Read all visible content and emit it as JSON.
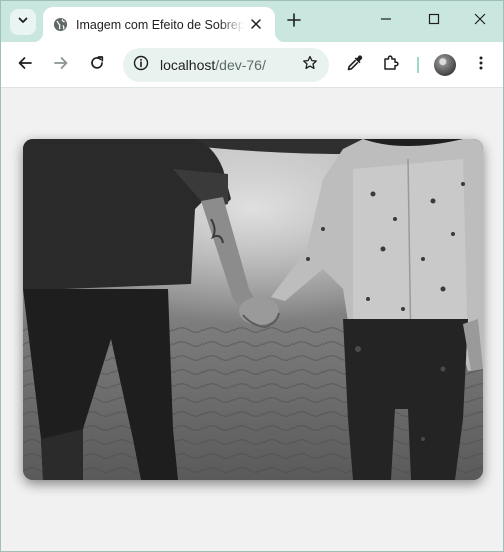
{
  "browser": {
    "tab": {
      "title": "Imagem com Efeito de Sobreposição",
      "favicon": "globe-icon"
    },
    "address_bar": {
      "host": "localhost",
      "path": "/dev-76/"
    },
    "icons": {
      "tab_search": "chevron-down-icon",
      "close_tab": "close-icon",
      "new_tab": "plus-icon",
      "minimize": "minimize-icon",
      "maximize": "maximize-icon",
      "close_window": "close-icon",
      "back": "arrow-left-icon",
      "forward": "arrow-right-icon",
      "reload": "reload-icon",
      "site_info": "info-icon",
      "bookmark": "star-icon",
      "eyedropper": "eyedropper-icon",
      "extensions": "puzzle-icon",
      "menu": "kebab-menu-icon"
    },
    "colors": {
      "frame": "#c9e6df",
      "omnibox": "#e8f2ef",
      "page_background": "#f1f1f1"
    }
  },
  "page": {
    "image": {
      "subject": "black-and-white photo of two people holding hands on a beach"
    }
  }
}
